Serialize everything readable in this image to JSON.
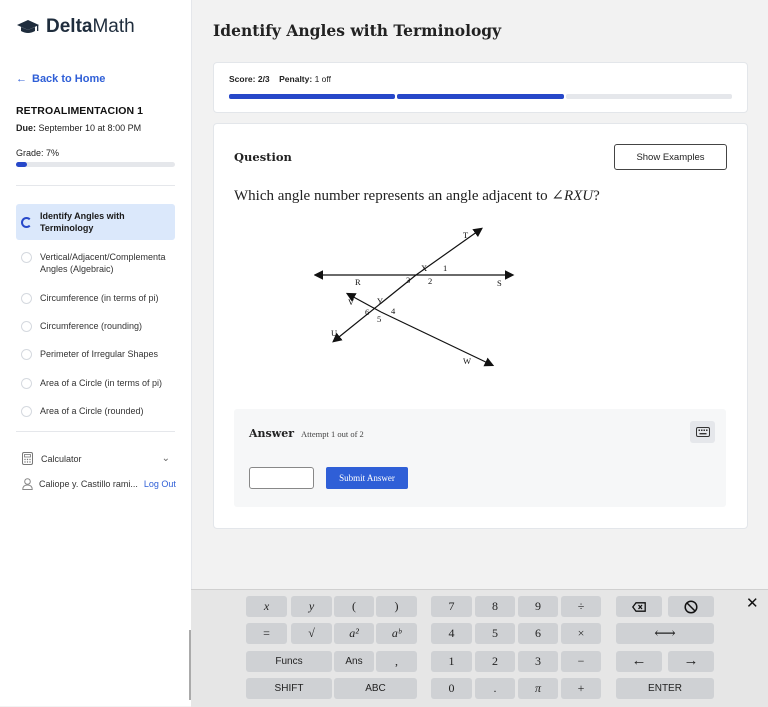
{
  "sidebar": {
    "brand_bold": "Delta",
    "brand_rest": "Math",
    "back_label": "Back to Home",
    "assignment_title": "RETROALIMENTACION 1",
    "due_label": "Due:",
    "due_value": "September 10 at 8:00 PM",
    "grade_text": "Grade: 7%",
    "grade_fraction": 0.07,
    "tasks": [
      {
        "label": "Identify Angles with Terminology",
        "active": true
      },
      {
        "label": "Vertical/Adjacent/Complementa Angles (Algebraic)"
      },
      {
        "label": "Circumference (in terms of pi)"
      },
      {
        "label": "Circumference (rounding)"
      },
      {
        "label": "Perimeter of Irregular Shapes"
      },
      {
        "label": "Area of a Circle (in terms of pi)"
      },
      {
        "label": "Area of a Circle (rounded)"
      }
    ],
    "calculator_label": "Calculator",
    "user_name": "Caliope y. Castillo rami...",
    "logout_label": "Log Out"
  },
  "main": {
    "title": "Identify Angles with Terminology",
    "score_label": "Score:",
    "score_value": "2/3",
    "penalty_label": "Penalty:",
    "penalty_value": "1 off",
    "progress_segments": [
      true,
      true,
      false
    ],
    "question_label": "Question",
    "show_examples_label": "Show Examples",
    "question_text": "Which angle number represents an angle adjacent to",
    "question_angle": "∠RXU",
    "question_end": "?",
    "diagram_labels": {
      "T": "T",
      "R": "R",
      "S": "S",
      "X": "X",
      "V": "V",
      "Y": "Y",
      "U": "U",
      "W": "W",
      "n1": "1",
      "n2": "2",
      "n3": "3",
      "n4": "4",
      "n5": "5",
      "n6": "6"
    },
    "answer_label": "Answer",
    "attempt_text": "Attempt 1 out of 2",
    "submit_label": "Submit Answer"
  },
  "keypad": {
    "vars": [
      "x",
      "y",
      "(",
      ")"
    ],
    "row2_left": [
      "=",
      "√",
      "a²",
      "aᵇ"
    ],
    "funcs_label": "Funcs",
    "ans_label": "Ans",
    "comma": ",",
    "shift_label": "SHIFT",
    "abc_label": "ABC",
    "digits": [
      [
        "7",
        "8",
        "9",
        "÷"
      ],
      [
        "4",
        "5",
        "6",
        "×"
      ],
      [
        "1",
        "2",
        "3",
        "−"
      ],
      [
        "0",
        ".",
        "π",
        "+"
      ]
    ],
    "backspace_icon": "backspace-icon",
    "clear_icon": "no-entry-icon",
    "leftright_label": "⟷",
    "left_arrow": "←",
    "right_arrow": "→",
    "enter_label": "ENTER",
    "close_label": "✕"
  }
}
